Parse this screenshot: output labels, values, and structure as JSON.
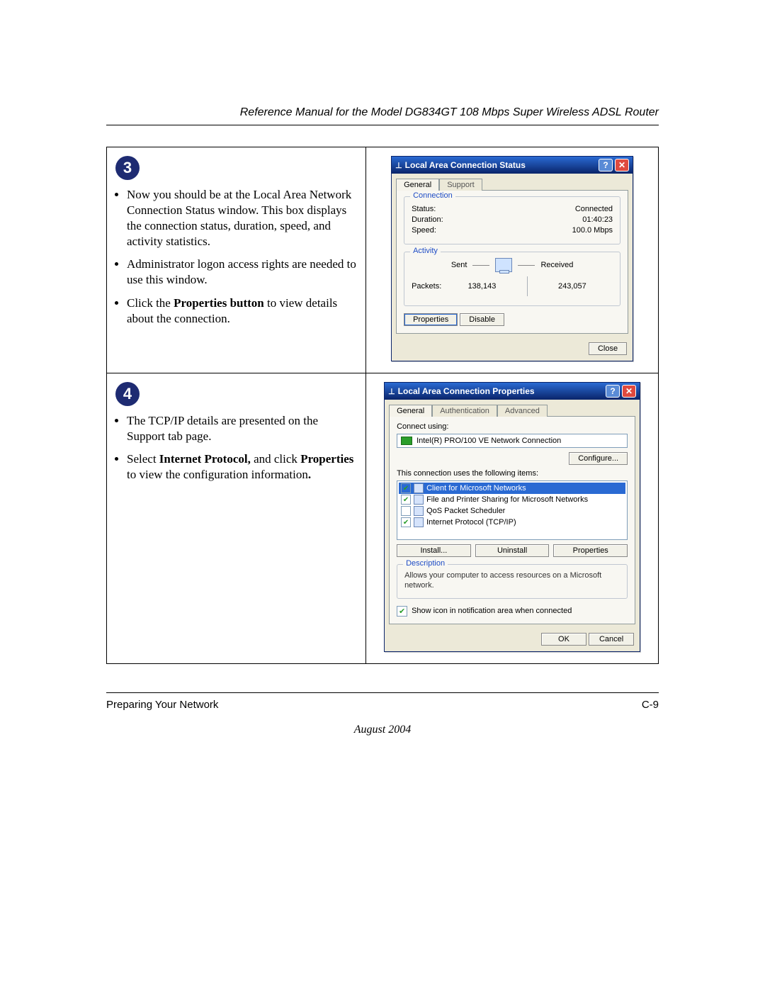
{
  "runningHead": "Reference Manual for the Model DG834GT 108 Mbps Super Wireless ADSL Router",
  "footer": {
    "left": "Preparing Your Network",
    "right": "C-9",
    "date": "August 2004"
  },
  "step3": {
    "badge": "3",
    "bullets": {
      "b0": "Now you should be at the Local Area Network Connection Status window. This box displays the connection status, duration, speed, and activity statistics.",
      "b1": "Administrator logon access rights are needed to use this window.",
      "b2a": "Click the ",
      "b2b": "Properties button",
      "b2c": " to view details about the connection."
    }
  },
  "step4": {
    "badge": "4",
    "bullets": {
      "b0": "The TCP/IP details are presented on the Support tab page.",
      "b1a": "Select ",
      "b1b": "Internet Protocol,",
      "b1c": " and click ",
      "b1d": "Properties",
      "b1e": " to view the configuration information",
      "b1f": "."
    }
  },
  "statusDialog": {
    "title": "Local Area Connection Status",
    "tabs": {
      "general": "General",
      "support": "Support"
    },
    "connection": {
      "legend": "Connection",
      "statusLabel": "Status:",
      "statusValue": "Connected",
      "durationLabel": "Duration:",
      "durationValue": "01:40:23",
      "speedLabel": "Speed:",
      "speedValue": "100.0 Mbps"
    },
    "activity": {
      "legend": "Activity",
      "sent": "Sent",
      "received": "Received",
      "packetsLabel": "Packets:",
      "sentValue": "138,143",
      "recvValue": "243,057"
    },
    "buttons": {
      "properties": "Properties",
      "disable": "Disable",
      "close": "Close"
    }
  },
  "propsDialog": {
    "title": "Local Area Connection Properties",
    "tabs": {
      "general": "General",
      "auth": "Authentication",
      "adv": "Advanced"
    },
    "connectUsing": "Connect using:",
    "adapter": "Intel(R) PRO/100 VE Network Connection",
    "configure": "Configure...",
    "itemsLabel": "This connection uses the following items:",
    "items": {
      "i0": "Client for Microsoft Networks",
      "i1": "File and Printer Sharing for Microsoft Networks",
      "i2": "QoS Packet Scheduler",
      "i3": "Internet Protocol (TCP/IP)"
    },
    "itemChecked": {
      "i0": true,
      "i1": true,
      "i2": false,
      "i3": true
    },
    "buttons": {
      "install": "Install...",
      "uninstall": "Uninstall",
      "properties": "Properties"
    },
    "descLegend": "Description",
    "descText": "Allows your computer to access resources on a Microsoft network.",
    "showIcon": "Show icon in notification area when connected",
    "ok": "OK",
    "cancel": "Cancel"
  }
}
